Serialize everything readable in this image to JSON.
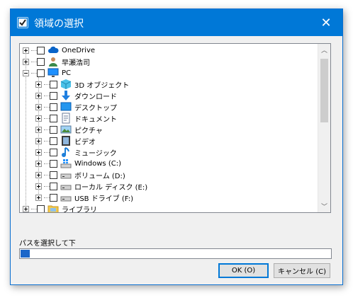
{
  "window": {
    "title": "領域の選択",
    "close_glyph": "✕"
  },
  "tree": {
    "items": [
      {
        "label": "OneDrive",
        "icon": "cloud-icon",
        "expander": "plus"
      },
      {
        "label": "早瀬浩司",
        "icon": "user-icon",
        "expander": "plus"
      },
      {
        "label": "PC",
        "icon": "computer-icon",
        "expander": "minus"
      },
      {
        "label": "3D オブジェクト",
        "icon": "3d-objects-icon",
        "expander": "plus"
      },
      {
        "label": "ダウンロード",
        "icon": "download-icon",
        "expander": "plus"
      },
      {
        "label": "デスクトップ",
        "icon": "desktop-icon",
        "expander": "plus"
      },
      {
        "label": "ドキュメント",
        "icon": "document-icon",
        "expander": "plus"
      },
      {
        "label": "ピクチャ",
        "icon": "pictures-icon",
        "expander": "plus"
      },
      {
        "label": "ビデオ",
        "icon": "video-icon",
        "expander": "plus"
      },
      {
        "label": "ミュージック",
        "icon": "music-icon",
        "expander": "plus"
      },
      {
        "label": "Windows (C:)",
        "icon": "windows-drive-icon",
        "expander": "plus"
      },
      {
        "label": "ボリューム (D:)",
        "icon": "drive-icon",
        "expander": "plus"
      },
      {
        "label": "ローカル ディスク (E:)",
        "icon": "drive-icon",
        "expander": "plus"
      },
      {
        "label": "USB ドライブ (F:)",
        "icon": "drive-icon",
        "expander": "plus"
      },
      {
        "label": "ライブラリ",
        "icon": "library-icon",
        "expander": "plus"
      }
    ]
  },
  "path_label": "パスを選択して下",
  "progress": {
    "fraction": 0.03
  },
  "buttons": {
    "ok": "OK (O)",
    "cancel": "キャンセル (C)"
  },
  "colors": {
    "titlebar": "#0078d7",
    "progress": "#1b66c9"
  }
}
